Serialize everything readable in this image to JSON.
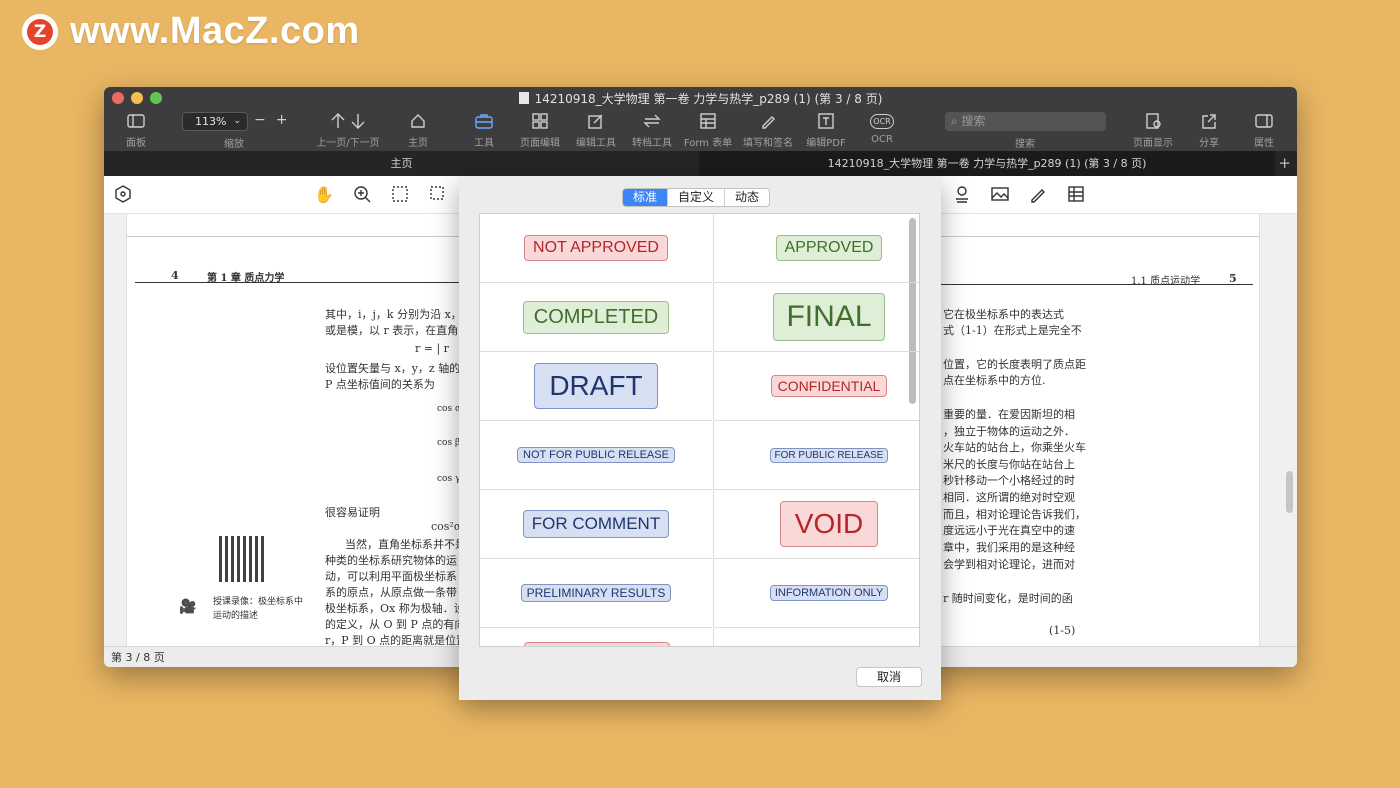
{
  "watermark": {
    "logo_letter": "Z",
    "text": "www.MacZ.com"
  },
  "window": {
    "title": "14210918_大学物理  第一卷  力学与热学_p289 (1) (第 3 / 8 页)",
    "traffic_colors": [
      "#ed6a5e",
      "#f5bf4f",
      "#61c554"
    ]
  },
  "toolbar": {
    "panel": "面板",
    "zoom_value": "113%",
    "zoom_label": "缩放",
    "zoom_minus": "−",
    "zoom_plus": "+",
    "prev_next": "上一页/下一页",
    "home": "主页",
    "tools": "工具",
    "page_edit": "页面编辑",
    "edit_tools": "编辑工具",
    "convert": "转档工具",
    "form": "Form 表单",
    "fill_sign": "填写和签名",
    "edit_pdf": "编辑PDF",
    "ocr": "OCR",
    "ocr_icon_text": "OCR",
    "search_placeholder": "搜索",
    "search_label": "搜索",
    "page_display": "页面显示",
    "share": "分享",
    "properties": "属性"
  },
  "tabs": {
    "home": "主页",
    "doc": "14210918_大学物理  第一卷  力学与热学_p289 (1) (第 3 / 8 页)",
    "plus": "+"
  },
  "page": {
    "left_header_num": "4",
    "left_header_title": "第 1 章   质点力学",
    "right_header_title": "1.1   质点运动学",
    "right_header_num": "5",
    "left_lines": [
      "其中，i，j，k 分别为沿 x，y，z 轴",
      "或是模，以 r 表示，在直角系",
      "r = | r",
      "设位置矢量与 x，y，z 轴的夹",
      "P 点坐标值间的关系为",
      "cos α",
      "cos β",
      "cos γ",
      "很容易证明",
      "cos²α +",
      "当然，直角坐标系并不是",
      "种类的坐标系研究物体的运",
      "动，可以利用平面极坐标系",
      "系的原点，从原点做一条带",
      "极坐标系，Ox 称为极轴．设",
      "的定义，从 O 到 P 点的有向",
      "r，P 到 O 点的距离就是位置"
    ],
    "qr_caption_1": "授课录像：极坐标系中",
    "qr_caption_2": "运动的描述",
    "right_lines": [
      "它在极坐标系中的表达式",
      "式（1-1）在形式上是完全不",
      "位置，它的长度表明了质点距",
      "点在坐标系中的方位.",
      "重要的量．在爱因斯坦的相",
      "，独立于物体的运动之外．",
      "火车站的站台上，你乘坐火车",
      "米尺的长度与你站在站台上",
      "秒针移动一个小格经过的时",
      "相同．这所谓的绝对时空观",
      "而且，相对论理论告诉我们，",
      "度远远小于光在真空中的速",
      "章中，我们采用的是这种经",
      "会学到相对论理论，进而对",
      "r 随时间变化，是时间的函",
      "(1-5)"
    ]
  },
  "status": {
    "page": "第 3 / 8 页"
  },
  "stamp_dialog": {
    "tabs": [
      "标准",
      "自定义",
      "动态"
    ],
    "active_tab": 0,
    "cancel": "取消",
    "stamps": [
      {
        "text": "NOT APPROVED",
        "color": "red"
      },
      {
        "text": "APPROVED",
        "color": "green"
      },
      {
        "text": "COMPLETED",
        "color": "green"
      },
      {
        "text": "FINAL",
        "color": "green"
      },
      {
        "text": "DRAFT",
        "color": "blue"
      },
      {
        "text": "CONFIDENTIAL",
        "color": "red"
      },
      {
        "text": "NOT FOR PUBLIC RELEASE",
        "color": "blue"
      },
      {
        "text": "FOR PUBLIC RELEASE",
        "color": "blue"
      },
      {
        "text": "FOR COMMENT",
        "color": "blue"
      },
      {
        "text": "VOID",
        "color": "red"
      },
      {
        "text": "PRELIMINARY RESULTS",
        "color": "blue"
      },
      {
        "text": "INFORMATION ONLY",
        "color": "blue"
      }
    ]
  }
}
